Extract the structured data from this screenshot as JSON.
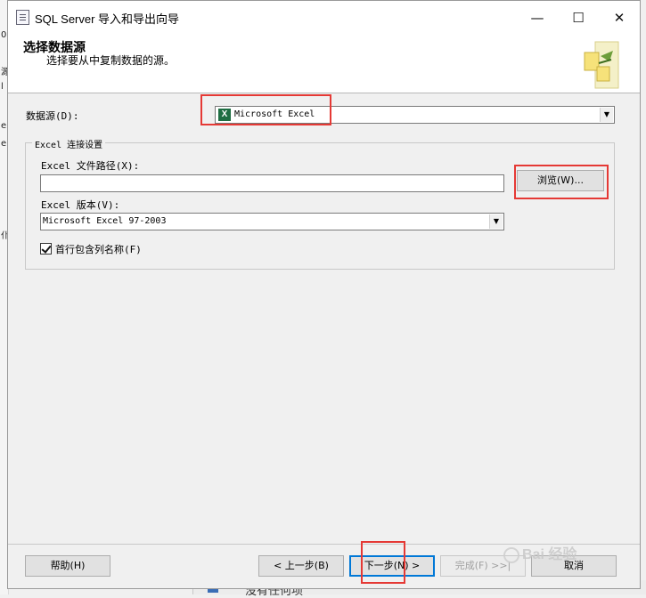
{
  "background": {
    "left_fragments": [
      "0",
      "源",
      "l",
      "e",
      "e",
      "仆"
    ],
    "bottom_text": "没有任何项"
  },
  "window": {
    "title": "SQL Server 导入和导出向导",
    "controls": {
      "minimize": "—",
      "maximize": "☐",
      "close": "✕"
    }
  },
  "header": {
    "title": "选择数据源",
    "subtitle": "选择要从中复制数据的源。"
  },
  "data_source": {
    "label": "数据源(D):",
    "value": "Microsoft Excel"
  },
  "excel_settings": {
    "group_label": "Excel 连接设置",
    "path_label": "Excel 文件路径(X):",
    "path_value": "",
    "browse_label": "浏览(W)...",
    "version_label": "Excel 版本(V):",
    "version_value": "Microsoft Excel 97-2003",
    "first_row_label": "首行包含列名称(F)",
    "first_row_checked": true
  },
  "footer": {
    "help": "帮助(H)",
    "back": "< 上一步(B)",
    "next": "下一步(N) >",
    "finish": "完成(F) >>|",
    "cancel": "取消"
  },
  "watermark": "Bai 经验",
  "colors": {
    "highlight": "#e53935",
    "excel_green": "#1f6e43",
    "default_button_border": "#0078d7"
  }
}
